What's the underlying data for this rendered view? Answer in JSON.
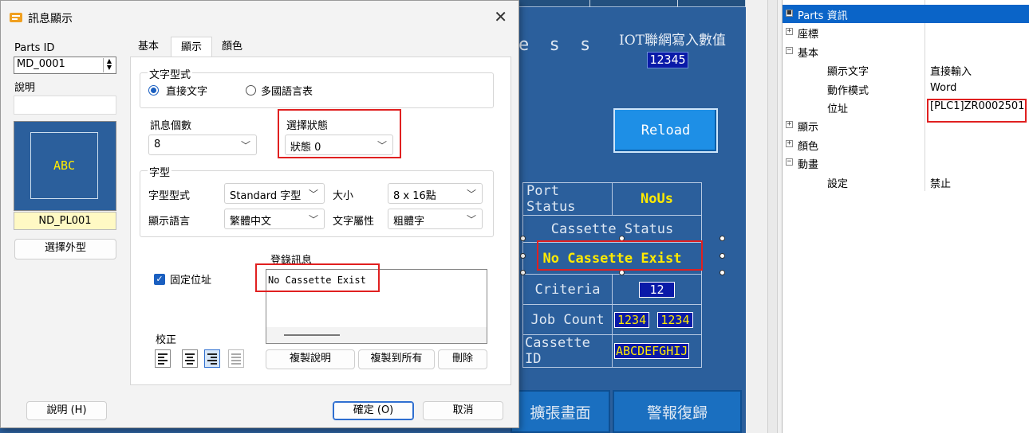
{
  "hmi": {
    "big_text": "e s s",
    "iot_title": "IOT聯網寫入數值",
    "iot_value": "12345",
    "reload_label": "Reload",
    "table": {
      "port_status_label": "Port Status",
      "port_status_value": "NoUs",
      "cassette_status_label": "Cassette Status",
      "cassette_status_value": "No Cassette Exist",
      "criteria_label": "Criteria",
      "criteria_value": "12",
      "job_count_label": "Job Count",
      "job_count_a": "1234",
      "job_count_b": "1234",
      "cassette_id_label": "Cassette ID",
      "cassette_id_value": "ABCDEFGHIJ"
    },
    "nav_left_label": "擴張畫面",
    "nav_right_label": "警報復歸"
  },
  "props": {
    "rows": [
      {
        "kind": "category",
        "expander": "■",
        "key": "Parts 資訊",
        "value": ""
      },
      {
        "kind": "category",
        "expander": "+",
        "key": "座標",
        "value": ""
      },
      {
        "kind": "category",
        "expander": "−",
        "key": "基本",
        "value": ""
      },
      {
        "kind": "item",
        "key": "顯示文字",
        "value": "直接輸入"
      },
      {
        "kind": "item",
        "key": "動作模式",
        "value": "Word"
      },
      {
        "kind": "item",
        "key": "位址",
        "value": "[PLC1]ZR0002501"
      },
      {
        "kind": "category",
        "expander": "+",
        "key": "顯示",
        "value": ""
      },
      {
        "kind": "category",
        "expander": "+",
        "key": "顏色",
        "value": ""
      },
      {
        "kind": "category",
        "expander": "−",
        "key": "動畫",
        "value": ""
      },
      {
        "kind": "item",
        "key": "設定",
        "value": "禁止"
      }
    ]
  },
  "dialog": {
    "title": "訊息顯示",
    "parts_id_label": "Parts ID",
    "parts_id_value": "MD_0001",
    "description_label": "說明",
    "description_value": "",
    "preview_text": "ABC",
    "shape_name": "ND_PL001",
    "choose_shape_label": "選擇外型",
    "tabs": [
      "基本",
      "顯示",
      "顏色"
    ],
    "text_format_group": "文字型式",
    "radio_direct": "直接文字",
    "radio_multilang": "多國語言表",
    "msg_count_label": "訊息個數",
    "msg_count_value": "8",
    "select_state_label": "選擇狀態",
    "select_state_value": "狀態 0",
    "font_group": "字型",
    "font_type_label": "字型型式",
    "font_type_value": "Standard 字型",
    "size_label": "大小",
    "size_value": "8 x 16點",
    "display_lang_label": "顯示語言",
    "display_lang_value": "繁體中文",
    "text_attr_label": "文字屬性",
    "text_attr_value": "粗體字",
    "registered_msg_label": "登錄訊息",
    "registered_msg_value": "No Cassette Exist",
    "fixed_address_label": "固定位址",
    "calibration_label": "校正",
    "copy_desc_label": "複製說明",
    "copy_all_label": "複製到所有",
    "delete_label": "刪除",
    "help_label": "說明 (H)",
    "ok_label": "確定 (O)",
    "cancel_label": "取消"
  }
}
